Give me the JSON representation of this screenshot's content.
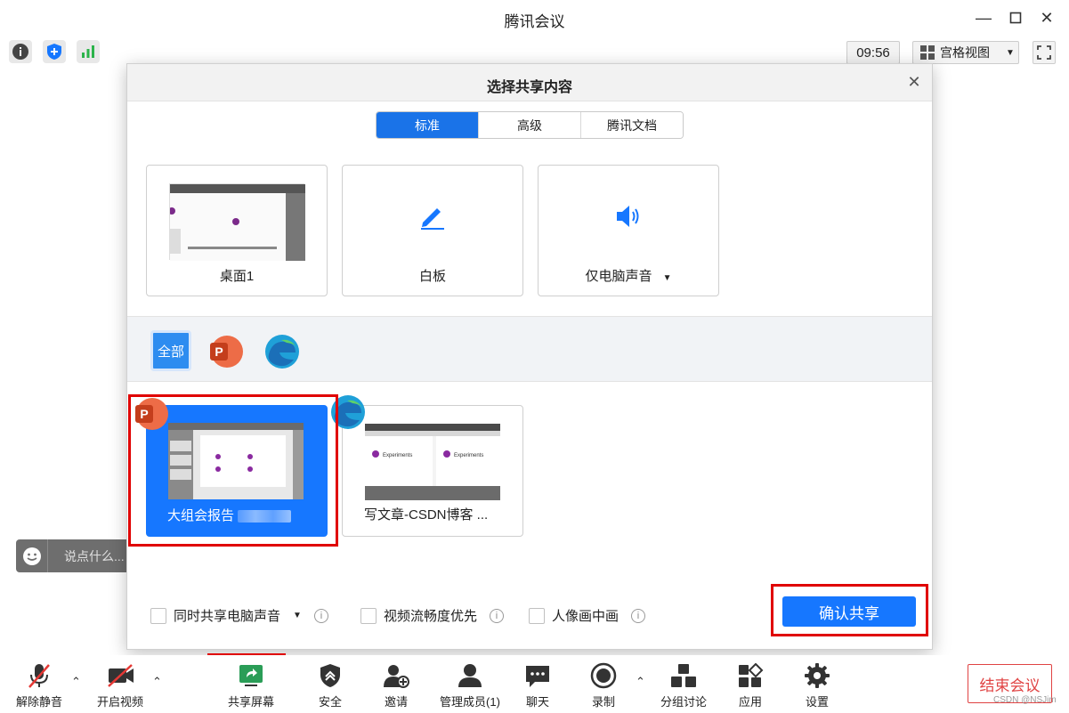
{
  "window": {
    "title": "腾讯会议"
  },
  "topbar": {
    "clock": "09:56",
    "view_label": "宫格视图"
  },
  "chat": {
    "placeholder": "说点什么..."
  },
  "dialog": {
    "title": "选择共享内容",
    "tabs": [
      "标准",
      "高级",
      "腾讯文档"
    ],
    "active_tab": "标准",
    "sources": [
      {
        "label": "桌面1",
        "icon": "desktop-thumbnail"
      },
      {
        "label": "白板",
        "icon": "pen-icon"
      },
      {
        "label": "仅电脑声音",
        "icon": "speaker-icon"
      }
    ],
    "filters": [
      {
        "label": "全部",
        "active": true
      },
      {
        "label": "",
        "icon": "powerpoint-icon"
      },
      {
        "label": "",
        "icon": "edge-icon"
      }
    ],
    "windows": [
      {
        "label": "大组会报告",
        "app_icon": "powerpoint-icon",
        "selected": true
      },
      {
        "label": "写文章-CSDN博客 ...",
        "app_icon": "edge-icon",
        "selected": false
      }
    ],
    "options": [
      {
        "label": "同时共享电脑声音",
        "checked": false,
        "has_dropdown": true
      },
      {
        "label": "视频流畅度优先",
        "checked": false
      },
      {
        "label": "人像画中画",
        "checked": false
      }
    ],
    "confirm_label": "确认共享"
  },
  "toolbar": {
    "items": [
      {
        "label": "解除静音",
        "icon": "mic-muted-icon"
      },
      {
        "label": "开启视频",
        "icon": "camera-off-icon"
      },
      {
        "label": "共享屏幕",
        "icon": "share-screen-icon"
      },
      {
        "label": "安全",
        "icon": "shield-icon"
      },
      {
        "label": "邀请",
        "icon": "invite-icon"
      },
      {
        "label": "管理成员(1)",
        "icon": "members-icon"
      },
      {
        "label": "聊天",
        "icon": "chat-icon"
      },
      {
        "label": "录制",
        "icon": "record-icon"
      },
      {
        "label": "分组讨论",
        "icon": "breakout-icon"
      },
      {
        "label": "应用",
        "icon": "apps-icon"
      },
      {
        "label": "设置",
        "icon": "settings-icon"
      }
    ],
    "end_label": "结束会议"
  },
  "watermark": "CSDN @NSJim",
  "colors": {
    "primary": "#1677ff",
    "highlight_border": "#e00000",
    "end_red": "#e04343"
  }
}
